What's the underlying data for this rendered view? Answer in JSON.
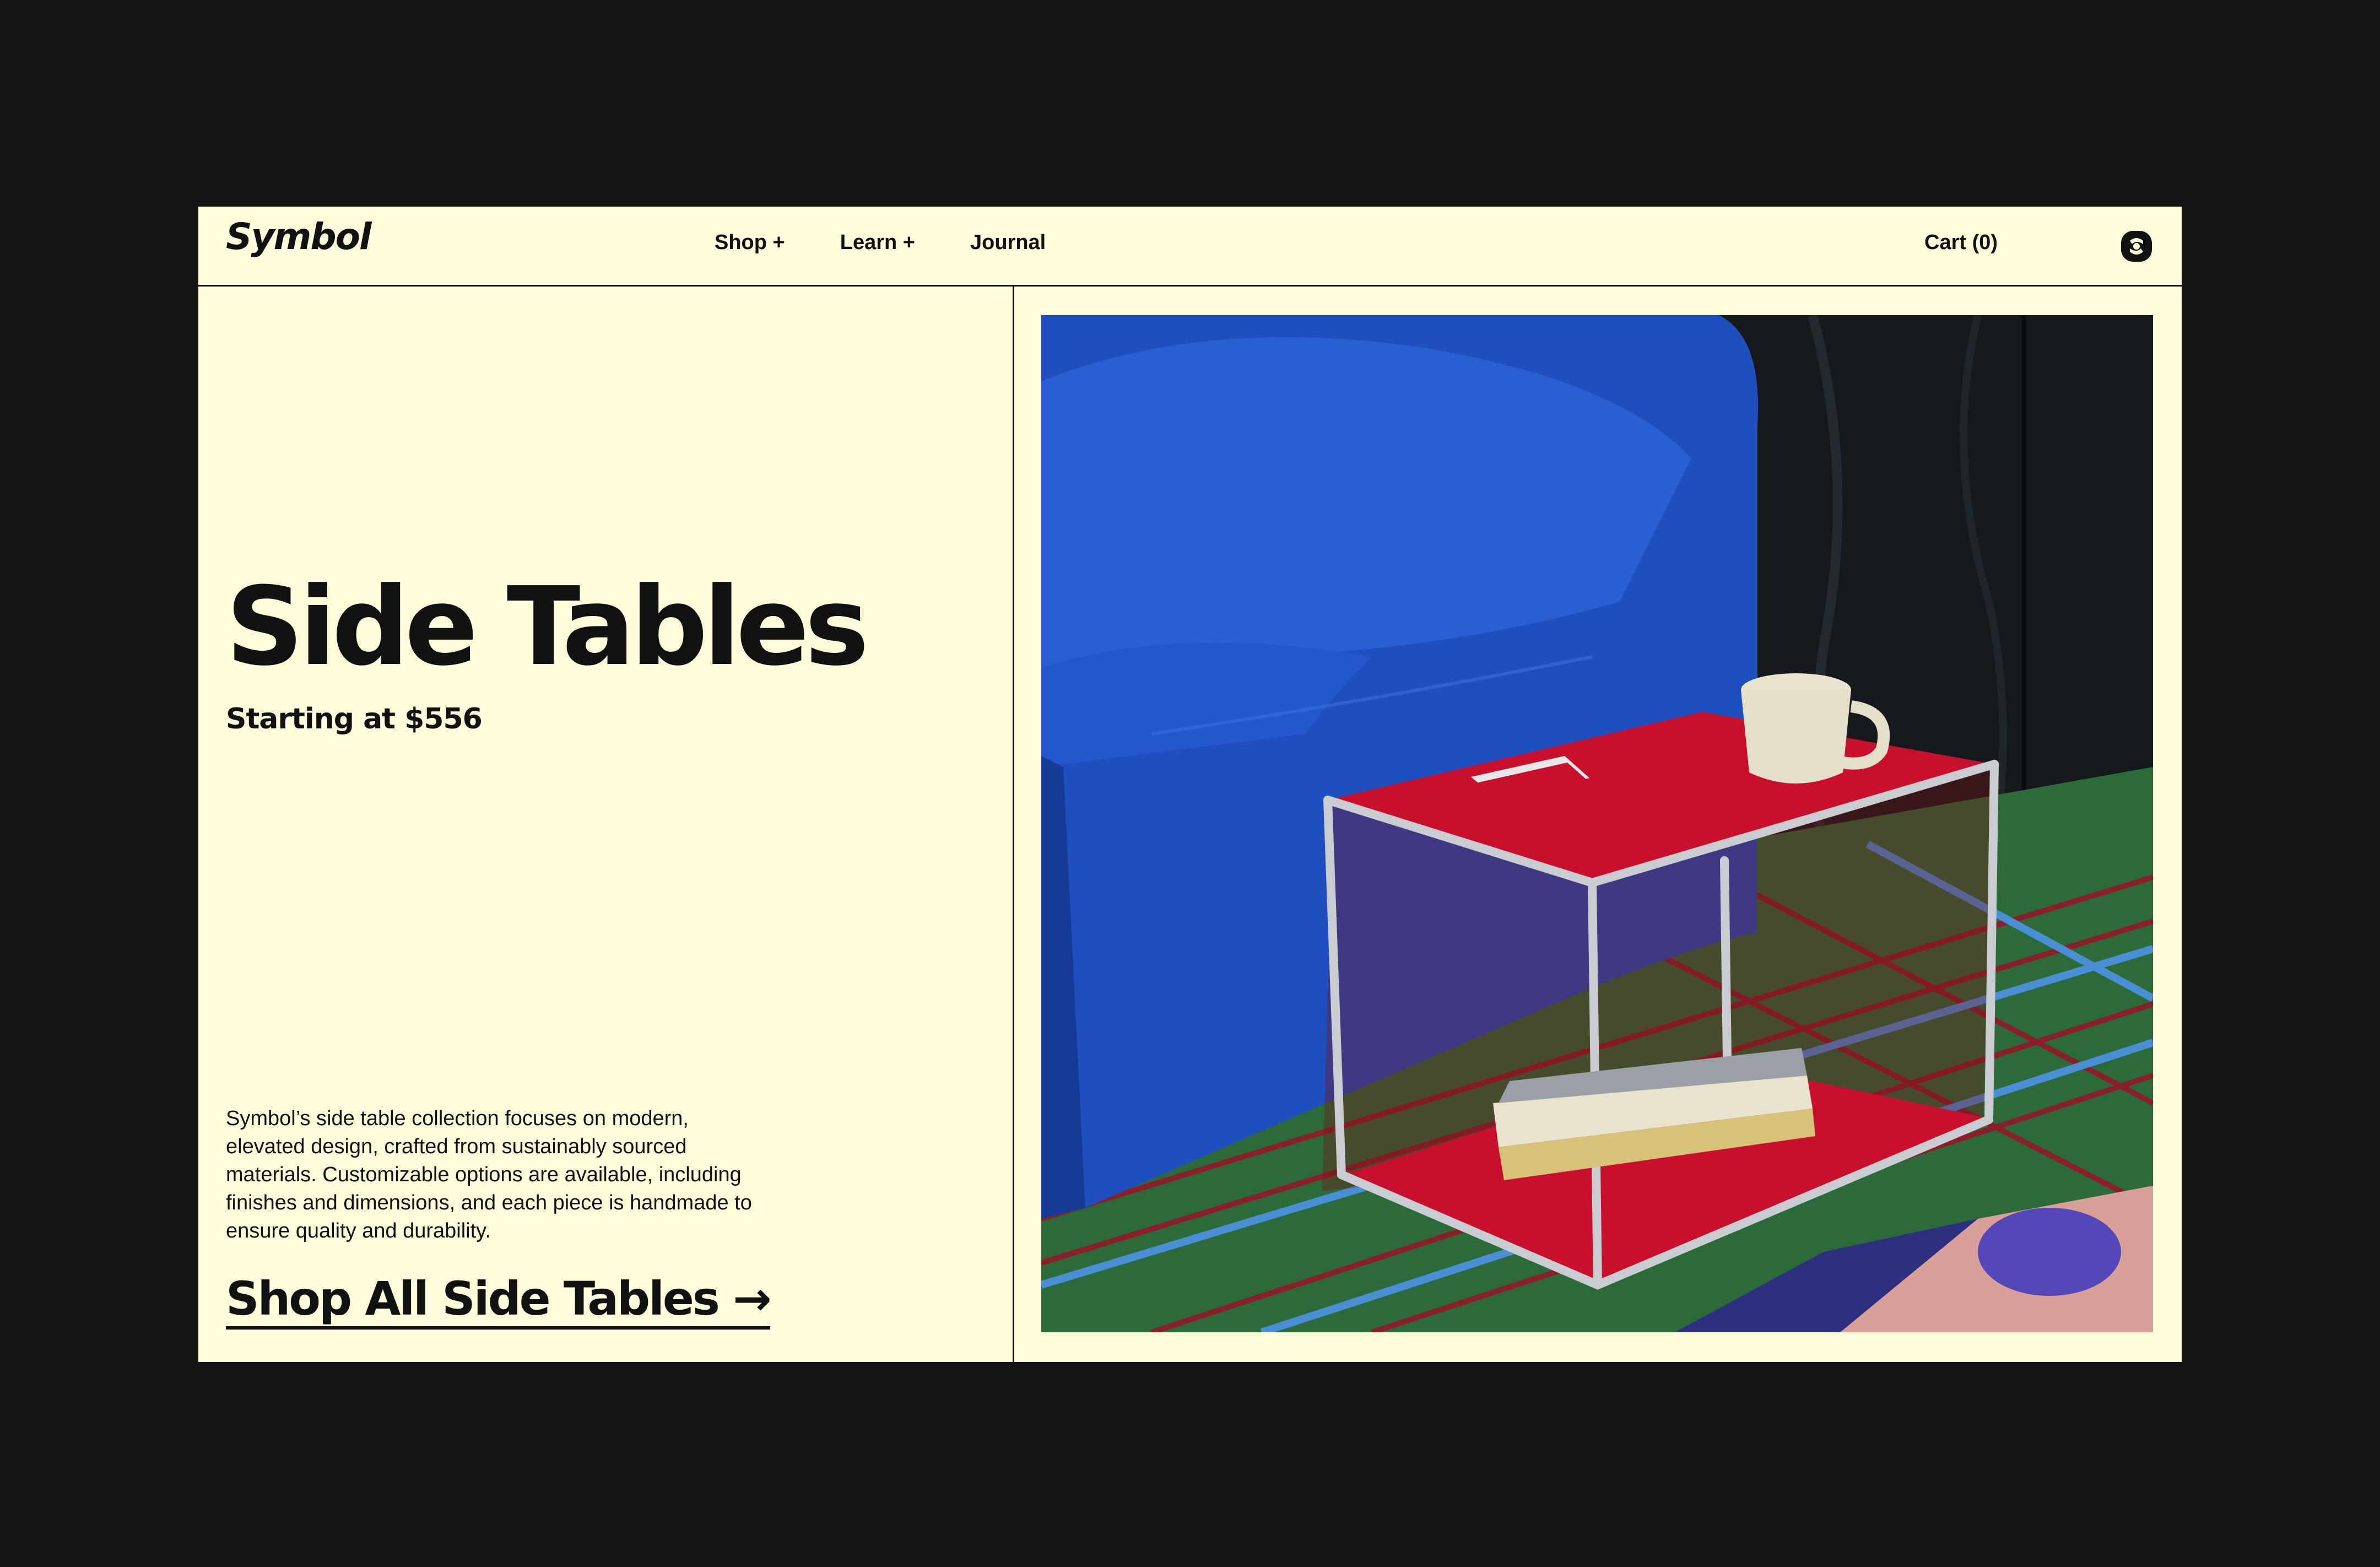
{
  "brand": {
    "logo_text": "Symbol"
  },
  "nav": {
    "items": [
      {
        "label": "Shop +"
      },
      {
        "label": "Learn +"
      },
      {
        "label": "Journal"
      }
    ],
    "cart_label": "Cart (0)"
  },
  "hero": {
    "title": "Side Tables",
    "subtitle": "Starting at $556",
    "description": "Symbol’s side table collection focuses on modern, elevated design, crafted from sustainably sourced materials. Customizable options are available, including finishes and dimensions, and each piece is handmade to ensure quality and durability.",
    "cta_label": "Shop All Side Tables →"
  },
  "colors": {
    "page_background": "#141414",
    "panel_background": "#fffcdc",
    "text": "#111111",
    "sofa_blue": "#1d4fc4",
    "table_red": "#c8102e",
    "rug_green": "#2d6b3a"
  }
}
